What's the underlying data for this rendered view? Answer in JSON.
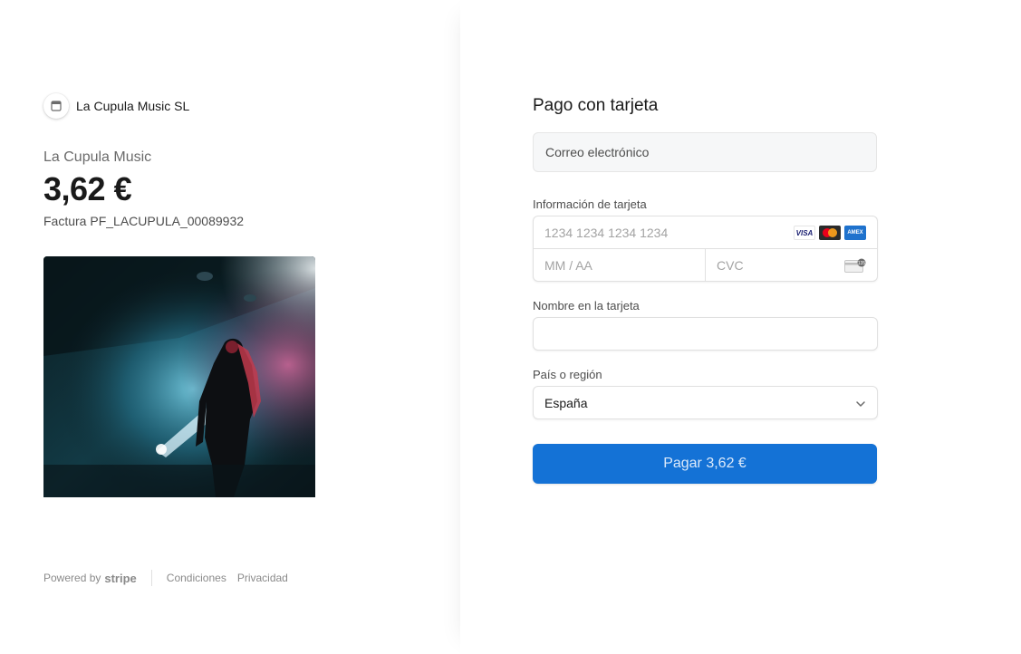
{
  "merchant": {
    "name": "La Cupula Music SL",
    "icon": "store-icon"
  },
  "product": {
    "name": "La Cupula Music",
    "amount": "3,62 €",
    "invoice": "Factura PF_LACUPULA_00089932",
    "image_description": "concert-photo"
  },
  "footer": {
    "powered_by": "Powered by",
    "stripe": "stripe",
    "terms": "Condiciones",
    "privacy": "Privacidad"
  },
  "payment": {
    "title": "Pago con tarjeta",
    "email_placeholder": "Correo electrónico",
    "card_info_label": "Información de tarjeta",
    "card_number_placeholder": "1234 1234 1234 1234",
    "expiry_placeholder": "MM / AA",
    "cvc_placeholder": "CVC",
    "card_brands": [
      "visa-icon",
      "mastercard-icon",
      "amex-icon"
    ],
    "name_label": "Nombre en la tarjeta",
    "name_value": "",
    "country_label": "País o región",
    "country_value": "España",
    "pay_button": "Pagar 3,62 €"
  },
  "colors": {
    "button": "#1472d6",
    "text": "#1a1a1a",
    "muted": "#6b6b6b"
  }
}
